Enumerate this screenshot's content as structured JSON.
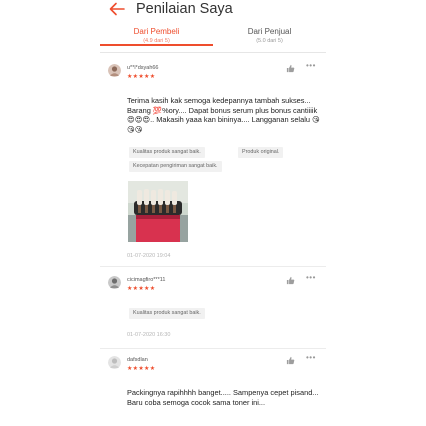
{
  "header": {
    "title": "Penilaian Saya",
    "accent": "#ee4d2d"
  },
  "tabs": [
    {
      "label": "Dari Pembeli",
      "sub": "(4.9 dari 5)",
      "active": true
    },
    {
      "label": "Dari Penjual",
      "sub": "(5.0 dari 5)",
      "active": false
    }
  ],
  "reviews": [
    {
      "username": "u**i*dsyah66",
      "stars": "★★★★★",
      "comment": "Terima kasih kak semoga kedepannya tambah sukses... Barang 💯%ory.... Dapat bonus serum plus bonus cantiiiik😍😍😍.. Makasih yaaa kan bininya.... Langganan selalu 😘😘😘",
      "tags": [
        "Kualitas produk sangat baik.",
        "Produk original.",
        "Kecepatan pengiriman sangat baik."
      ],
      "date": "01-07-2020 19:04"
    },
    {
      "username": "cicimagfiro***11",
      "stars": "★★★★★",
      "tags": [
        "Kualitas produk sangat baik."
      ],
      "date": "01-07-2020 16:30"
    },
    {
      "username": "dafsdlan",
      "stars": "★★★★★",
      "comment": "Packingnya rapihhhh banget..... Sampenya cepet pisand...\nBaru coba semoga cocok sama toner ini..."
    }
  ]
}
